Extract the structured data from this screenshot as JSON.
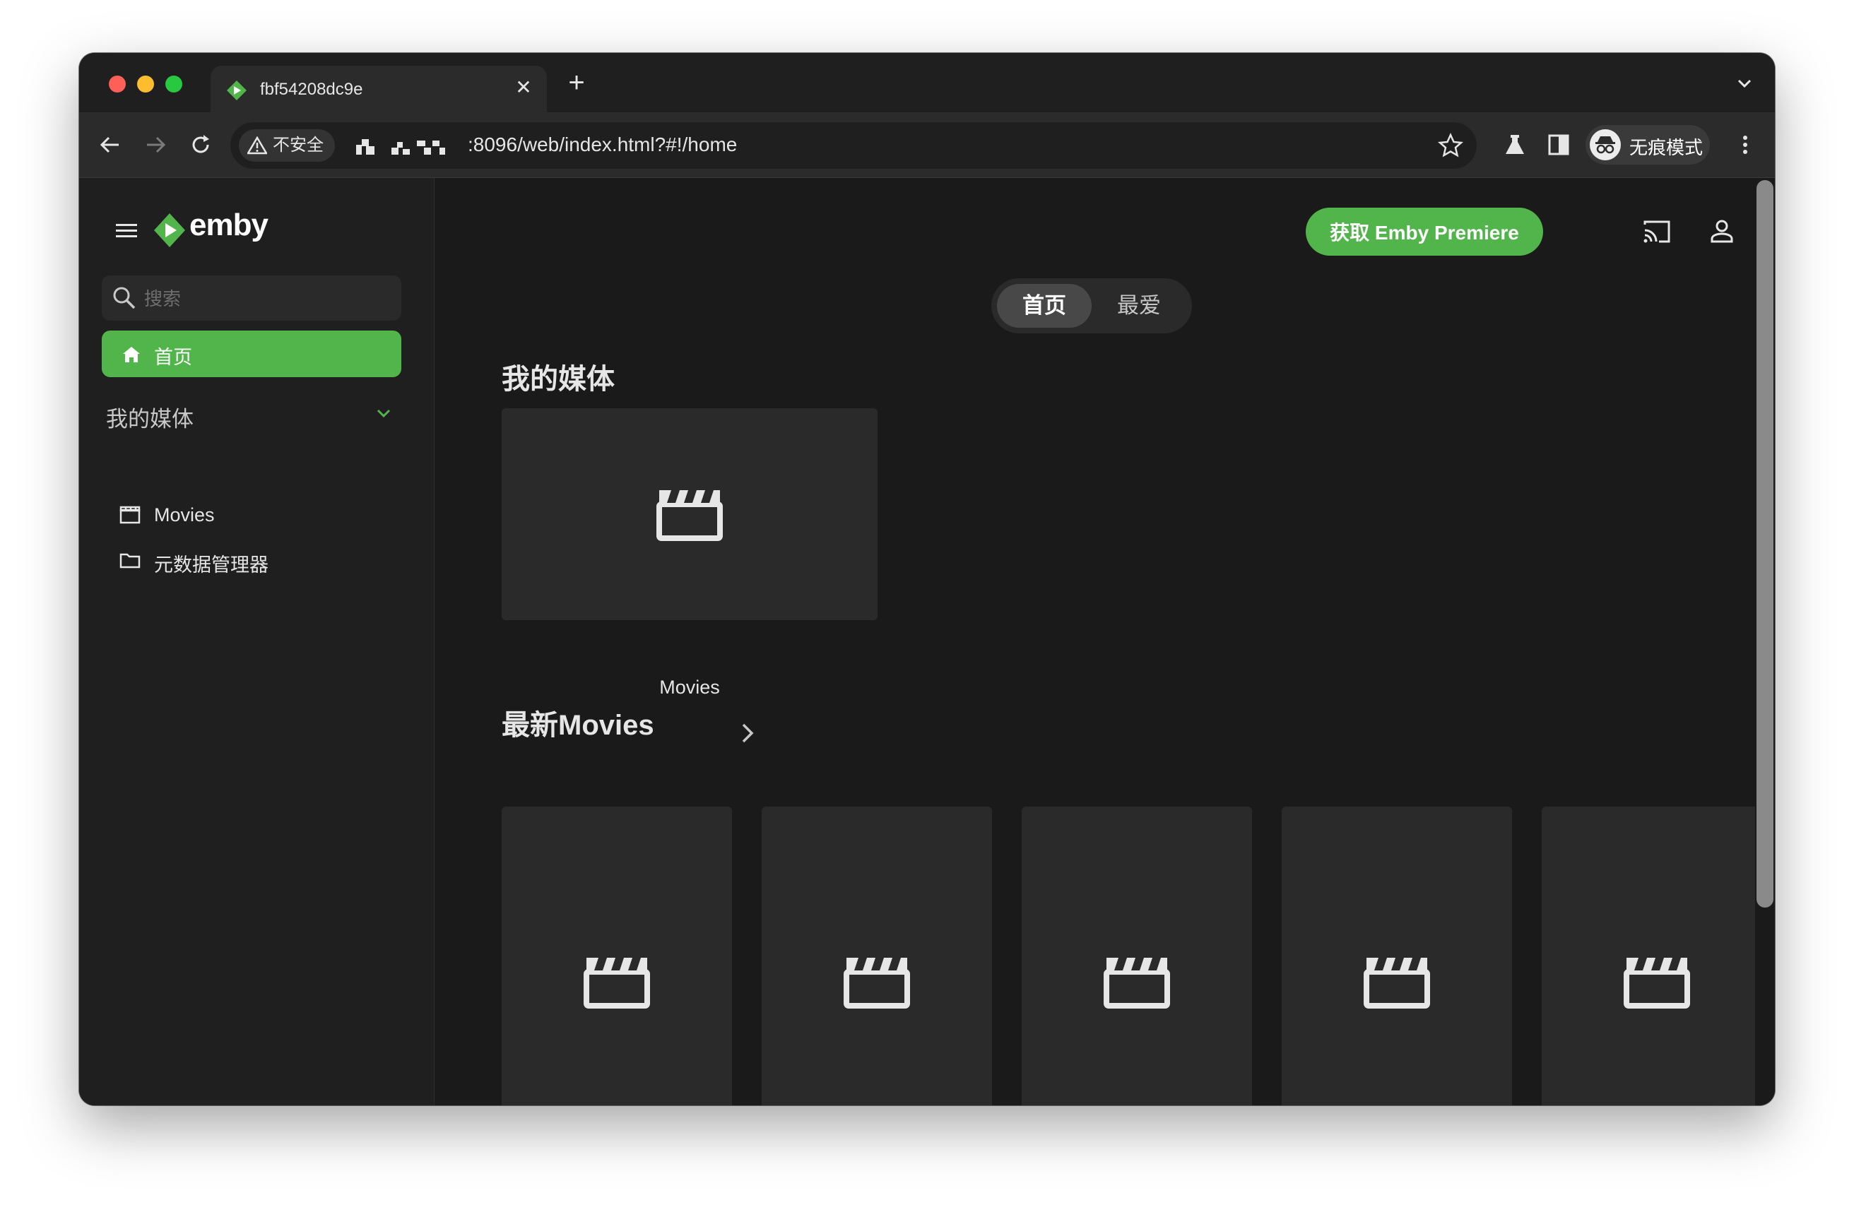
{
  "browser": {
    "tab_title": "fbf54208dc9e",
    "security_label": "不安全",
    "url": ":8096/web/index.html?#!/home",
    "incognito_label": "无痕模式"
  },
  "app": {
    "logo_text": "emby",
    "search_placeholder": "搜索",
    "nav_home": "首页",
    "sidebar_section": "我的媒体",
    "sidebar_items": [
      {
        "label": "Movies",
        "icon": "movie-icon"
      },
      {
        "label": "元数据管理器",
        "icon": "folder-icon"
      }
    ],
    "premiere_button": "获取 Emby Premiere",
    "tabs": [
      "首页",
      "最爱"
    ],
    "my_media_title": "我的媒体",
    "media_cards": [
      {
        "label": "Movies"
      }
    ],
    "latest_title": "最新Movies",
    "latest_poster_count": 5
  },
  "colors": {
    "accent": "#52b54b",
    "background": "#1a1a1a",
    "sidebar": "#1f1f1f",
    "card": "#2a2a2a"
  }
}
